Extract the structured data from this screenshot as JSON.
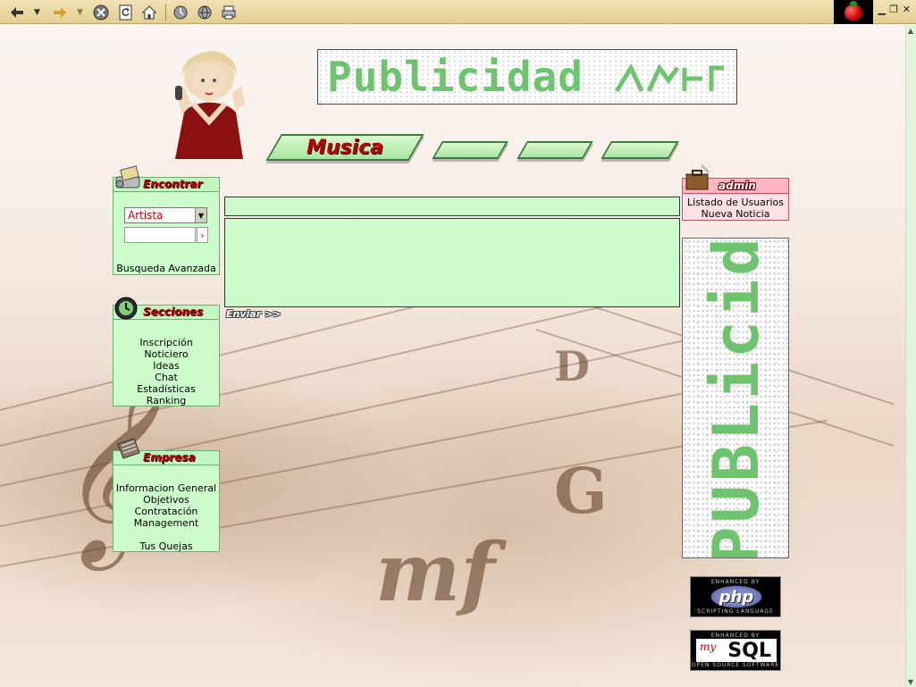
{
  "toolbar": {
    "icons": [
      "back-icon",
      "forward-icon",
      "stop-icon",
      "reload-icon",
      "home-icon",
      "history-icon",
      "print-icon"
    ]
  },
  "banner": {
    "text": "Publicidad"
  },
  "tabs": [
    {
      "label": "Musica"
    },
    {
      "label": ""
    },
    {
      "label": ""
    },
    {
      "label": ""
    }
  ],
  "search_box": {
    "title": "Encontrar",
    "select_value": "Artista",
    "go_label": "›",
    "advanced_link": "Busqueda Avanzada"
  },
  "sections_box": {
    "title": "Secciones",
    "items": [
      "Inscripción",
      "Noticiero",
      "Ideas",
      "Chat",
      "Estadísticas",
      "Ranking"
    ]
  },
  "company_box": {
    "title": "Empresa",
    "items": [
      "Informacion General",
      "Objetivos",
      "Contratación",
      "Management",
      "",
      "Tus Quejas"
    ]
  },
  "form": {
    "subject_value": "",
    "message_value": "",
    "send_label": "Enviar >>"
  },
  "admin_box": {
    "title": "admin",
    "items": [
      "Listado de Usuarios",
      "Nueva Noticia"
    ]
  },
  "side_ad": {
    "text": "PUBLicid"
  },
  "badges": {
    "php": {
      "top": "ENHANCED BY",
      "logo": "php",
      "bottom": "SCRIPTING LANGUAGE"
    },
    "mysql": {
      "top": "ENHANCED BY",
      "logo_prefix": "my",
      "logo": "SQL",
      "bottom": "OPEN SOURCE SOFTWARE"
    }
  },
  "colors": {
    "box_bg": "#ccfccc",
    "accent_red": "#b80000",
    "ad_green": "#6ec46e",
    "admin_bg": "#ffe0e6"
  }
}
